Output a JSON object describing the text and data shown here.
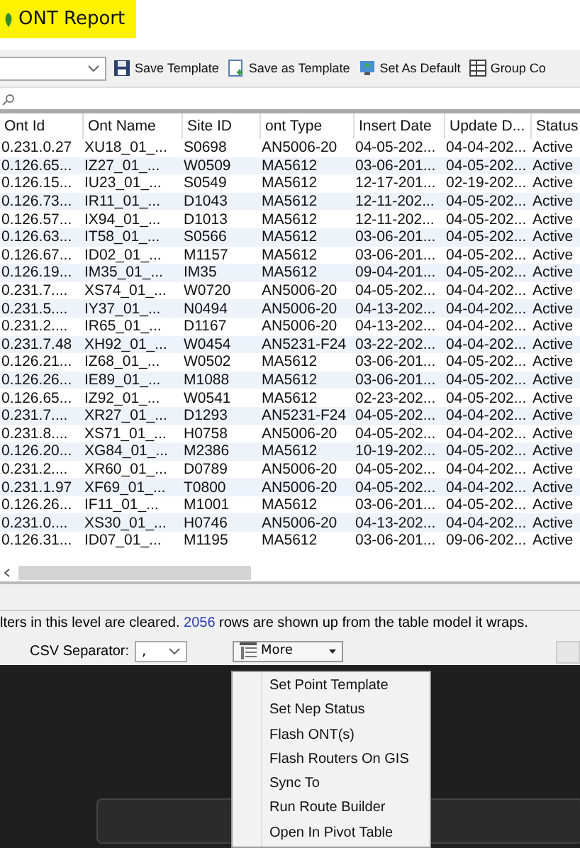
{
  "window": {
    "title": "ONT Report",
    "title_highlighted": true
  },
  "toolbar": {
    "buttons": [
      {
        "label": "Save Template",
        "kind": "save"
      },
      {
        "label": "Save as Template",
        "kind": "saveas"
      },
      {
        "label": "Set As Default",
        "kind": "default"
      },
      {
        "label": "Group Co",
        "kind": "group"
      }
    ]
  },
  "table": {
    "columns": [
      "Ont Id",
      "Ont Name",
      "Site ID",
      "ont Type",
      "Insert Date",
      "Update D...",
      "Status"
    ],
    "rows": [
      [
        "0.231.0.27",
        "XU18_01_...",
        "S0698",
        "AN5006-20",
        "04-05-202...",
        "04-04-202...",
        "Active"
      ],
      [
        "0.126.65...",
        "IZ27_01_...",
        "W0509",
        "MA5612",
        "03-06-201...",
        "04-05-202...",
        "Active"
      ],
      [
        "0.126.15...",
        "IU23_01_...",
        "S0549",
        "MA5612",
        "12-17-201...",
        "02-19-202...",
        "Active"
      ],
      [
        "0.126.73...",
        "IR11_01_...",
        "D1043",
        "MA5612",
        "12-11-202...",
        "04-05-202...",
        "Active"
      ],
      [
        "0.126.57...",
        "IX94_01_...",
        "D1013",
        "MA5612",
        "12-11-202...",
        "04-05-202...",
        "Active"
      ],
      [
        "0.126.63...",
        "IT58_01_...",
        "S0566",
        "MA5612",
        "03-06-201...",
        "04-05-202...",
        "Active"
      ],
      [
        "0.126.67...",
        "ID02_01_...",
        "M1157",
        "MA5612",
        "03-06-201...",
        "04-05-202...",
        "Active"
      ],
      [
        "0.126.19...",
        "IM35_01_...",
        "IM35",
        "MA5612",
        "09-04-201...",
        "04-05-202...",
        "Active"
      ],
      [
        "0.231.7....",
        "XS74_01_...",
        "W0720",
        "AN5006-20",
        "04-05-202...",
        "04-04-202...",
        "Active"
      ],
      [
        "0.231.5....",
        "IY37_01_...",
        "N0494",
        "AN5006-20",
        "04-13-202...",
        "04-04-202...",
        "Active"
      ],
      [
        "0.231.2....",
        "IR65_01_...",
        "D1167",
        "AN5006-20",
        "04-13-202...",
        "04-04-202...",
        "Active"
      ],
      [
        "0.231.7.48",
        "XH92_01_...",
        "W0454",
        "AN5231-F24",
        "03-22-202...",
        "04-04-202...",
        "Active"
      ],
      [
        "0.126.21...",
        "IZ68_01_...",
        "W0502",
        "MA5612",
        "03-06-201...",
        "04-05-202...",
        "Active"
      ],
      [
        "0.126.26...",
        "IE89_01_...",
        "M1088",
        "MA5612",
        "03-06-201...",
        "04-05-202...",
        "Active"
      ],
      [
        "0.126.65...",
        "IZ92_01_...",
        "W0541",
        "MA5612",
        "02-23-202...",
        "04-05-202...",
        "Active"
      ],
      [
        "0.231.7....",
        "XR27_01_...",
        "D1293",
        "AN5231-F24",
        "04-05-202...",
        "04-04-202...",
        "Active"
      ],
      [
        "0.231.8....",
        "XS71_01_...",
        "H0758",
        "AN5006-20",
        "04-05-202...",
        "04-04-202...",
        "Active"
      ],
      [
        "0.126.20...",
        "XG84_01_...",
        "M2386",
        "MA5612",
        "10-19-202...",
        "04-05-202...",
        "Active"
      ],
      [
        "0.231.2....",
        "XR60_01_...",
        "D0789",
        "AN5006-20",
        "04-05-202...",
        "04-04-202...",
        "Active"
      ],
      [
        "0.231.1.97",
        "XF69_01_...",
        "T0800",
        "AN5006-20",
        "04-05-202...",
        "04-04-202...",
        "Active"
      ],
      [
        "0.126.26...",
        "IF11_01_...",
        "M1001",
        "MA5612",
        "03-06-201...",
        "04-05-202...",
        "Active"
      ],
      [
        "0.231.0....",
        "XS30_01_...",
        "H0746",
        "AN5006-20",
        "04-13-202...",
        "04-04-202...",
        "Active"
      ],
      [
        "0.126.31...",
        "ID07_01_...",
        "M1195",
        "MA5612",
        "03-06-201...",
        "09-06-202...",
        "Active"
      ]
    ]
  },
  "status_text": "lters in this level are cleared. **2056** rows are shown up from the table model it wraps.",
  "csv_separator": {
    "label": "CSV Separator:",
    "value": ","
  },
  "more_menu": {
    "label": "More",
    "items": [
      "Set Point Template",
      "Set Nep Status",
      "Flash ONT(s)",
      "Flash Routers On GIS",
      "Sync To",
      "Run Route Builder",
      "Open In Pivot Table"
    ]
  }
}
